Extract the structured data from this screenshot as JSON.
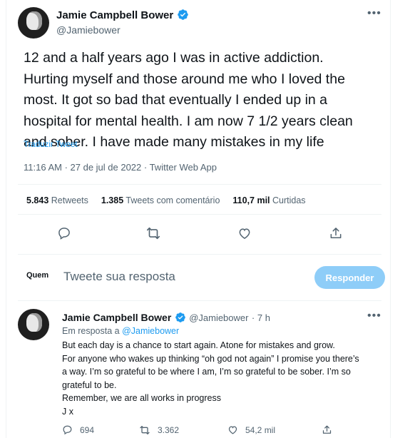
{
  "tweet": {
    "author_name": "Jamie Campbell Bower",
    "author_handle": "@Jamiebower",
    "lines": [
      "12 and a half years ago I was in active addiction.",
      "Hurting myself and those around me who I loved the",
      "most. It got so bad that eventually I ended up in a",
      "hospital for mental health. I am now 7 1/2 years clean",
      "and sober. I have made many mistakes in my life"
    ],
    "translate_label": "Traduzir Tweet",
    "meta": "11:16 AM · 27 de jul de 2022 · Twitter Web App",
    "stats": {
      "retweets_count": "5.843",
      "retweets_label": "Retweets",
      "quotes_count": "1.385",
      "quotes_label": "Tweets com comentário",
      "likes_count": "110,7 mil",
      "likes_label": "Curtidas"
    }
  },
  "reply_box": {
    "who_label": "Quem",
    "placeholder": "Tweete sua resposta",
    "button_label": "Responder"
  },
  "reply_tweet": {
    "author_name": "Jamie Campbell Bower",
    "author_handle": "@Jamiebower",
    "time": "· 7 h",
    "in_reply_prefix": "Em resposta a",
    "in_reply_handle": "@Jamiebower",
    "lines": [
      "But each day is a chance to start again. Atone for mistakes and grow.",
      "For anyone who wakes up thinking “oh god not again” I promise you there’s",
      "a way. I’m so grateful to be where I am, I’m so grateful to be sober. I’m so",
      "grateful to be.",
      "Remember, we are all works in progress",
      "J x"
    ],
    "reply_count": "694",
    "retweet_count": "3.362",
    "like_count": "54,2 mil"
  },
  "colors": {
    "accent": "#1d9bf0",
    "button_disabled": "#8ecdf8",
    "secondary_text": "#536471"
  },
  "icons": [
    "verified-badge-icon",
    "more-icon",
    "reply-icon",
    "retweet-icon",
    "like-icon",
    "share-icon"
  ]
}
